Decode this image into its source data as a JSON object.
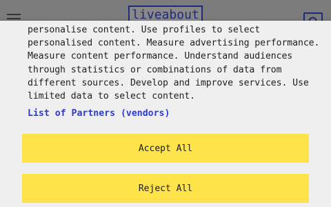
{
  "header": {
    "logo_text": "liveabout",
    "menu_icon": "hamburger-icon",
    "search_icon": "search-icon"
  },
  "consent": {
    "body_text": "personalise content. Use profiles to select\npersonalised content. Measure advertising performance.\nMeasure content performance. Understand audiences\nthrough statistics or combinations of data from\ndifferent sources. Develop and improve services. Use\nlimited data to select content.",
    "partners_link": "List of Partners (vendors)",
    "accept_label": "Accept All",
    "reject_label": "Reject All"
  },
  "colors": {
    "button_bg": "#ffe34a",
    "link": "#2b3bd4",
    "panel_bg": "#efefef"
  }
}
